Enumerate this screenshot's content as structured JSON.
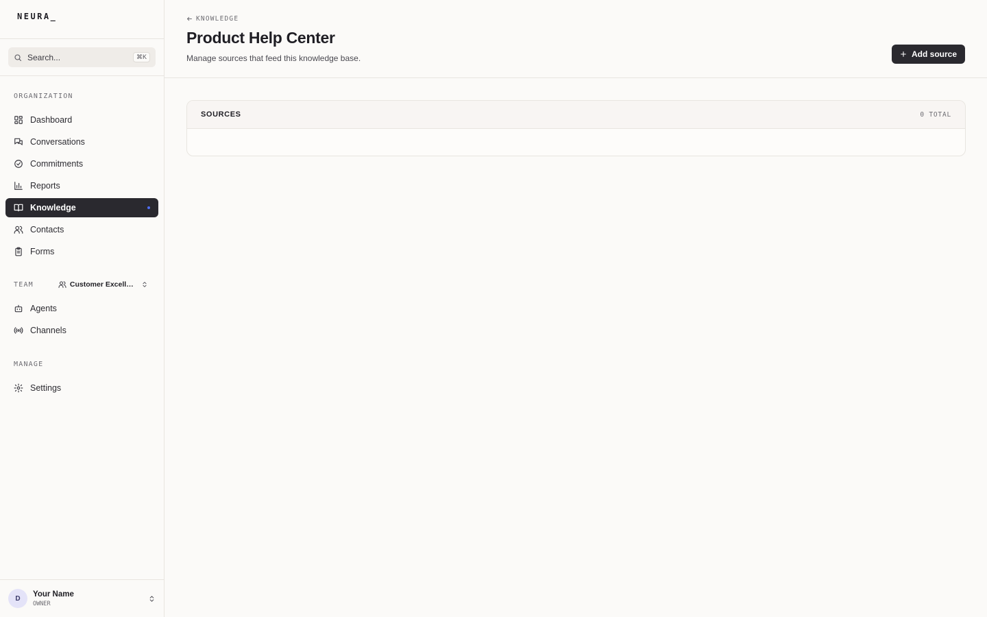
{
  "app": {
    "logo": "NEURA_"
  },
  "search": {
    "placeholder": "Search...",
    "shortcut": "⌘K"
  },
  "sidebar": {
    "organization_label": "ORGANIZATION",
    "org_items": [
      {
        "label": "Dashboard",
        "icon": "dashboard-icon"
      },
      {
        "label": "Conversations",
        "icon": "conversations-icon"
      },
      {
        "label": "Commitments",
        "icon": "check-circle-icon"
      },
      {
        "label": "Reports",
        "icon": "bar-chart-icon"
      },
      {
        "label": "Knowledge",
        "icon": "book-icon",
        "active": true
      },
      {
        "label": "Contacts",
        "icon": "users-icon"
      },
      {
        "label": "Forms",
        "icon": "clipboard-icon"
      }
    ],
    "team_label": "TEAM",
    "team_selector": "Customer Excellence",
    "team_items": [
      {
        "label": "Agents",
        "icon": "bot-icon"
      },
      {
        "label": "Channels",
        "icon": "broadcast-icon"
      }
    ],
    "manage_label": "MANAGE",
    "manage_items": [
      {
        "label": "Settings",
        "icon": "gear-icon"
      }
    ]
  },
  "user": {
    "initial": "D",
    "name": "Your Name",
    "role": "OWNER"
  },
  "header": {
    "breadcrumb": "KNOWLEDGE",
    "title": "Product Help Center",
    "subtitle": "Manage sources that feed this knowledge base.",
    "add_button": "Add source"
  },
  "sources": {
    "title": "SOURCES",
    "count": "0 TOTAL"
  },
  "colors": {
    "accent_dark": "#2a292f",
    "active_dot": "#4f6df5",
    "background": "#fbfaf8"
  }
}
